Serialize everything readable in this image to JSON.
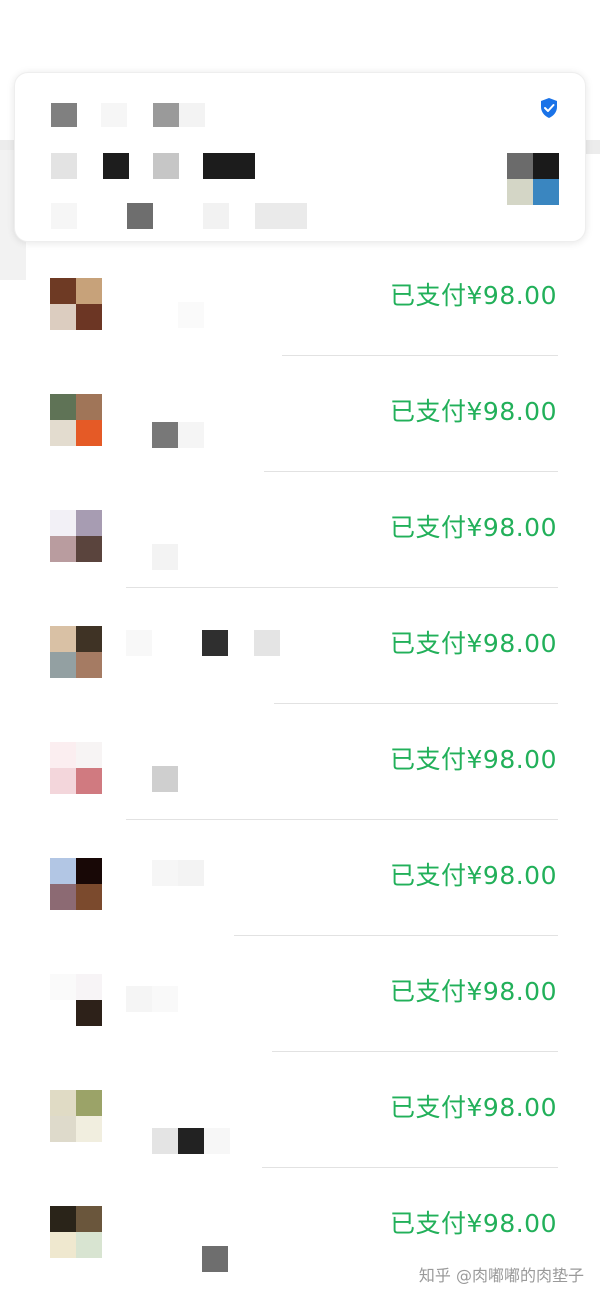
{
  "header": {
    "verified_icon": "shield-check-icon",
    "accent_color": "#1a73e8"
  },
  "orders": [
    {
      "status": "已支付¥98.00",
      "avatar": [
        "#6e3a24",
        "#c7a27a",
        "#dccdc0",
        "#6c3624"
      ]
    },
    {
      "status": "已支付¥98.00",
      "avatar": [
        "#5f7356",
        "#a07558",
        "#e3dccf",
        "#e55a26"
      ]
    },
    {
      "status": "已支付¥98.00",
      "avatar": [
        "#f2f0f6",
        "#a79cb2",
        "#b99c9f",
        "#5a443d"
      ]
    },
    {
      "status": "已支付¥98.00",
      "avatar": [
        "#d9c1a5",
        "#3f3325",
        "#93a0a2",
        "#a57b63"
      ]
    },
    {
      "status": "已支付¥98.00",
      "avatar": [
        "#fbeef0",
        "#f7f4f4",
        "#f3d6db",
        "#d07a80"
      ]
    },
    {
      "status": "已支付¥98.00",
      "avatar": [
        "#b2c6e4",
        "#180806",
        "#8c6a73",
        "#7b4a2d"
      ]
    },
    {
      "status": "已支付¥98.00",
      "avatar": [
        "#fafafa",
        "#f7f4f6",
        "#ffffff",
        "#2d2119"
      ]
    },
    {
      "status": "已支付¥98.00",
      "avatar": [
        "#e0dbc5",
        "#9ba368",
        "#dedacb",
        "#f1eedf"
      ]
    },
    {
      "status": "已支付¥98.00",
      "avatar": [
        "#2a2419",
        "#6a563c",
        "#efe8cf",
        "#d8e4d1"
      ]
    }
  ],
  "status_color": "#22b05a",
  "watermark": "知乎 @肉嘟嘟的肉垫子"
}
